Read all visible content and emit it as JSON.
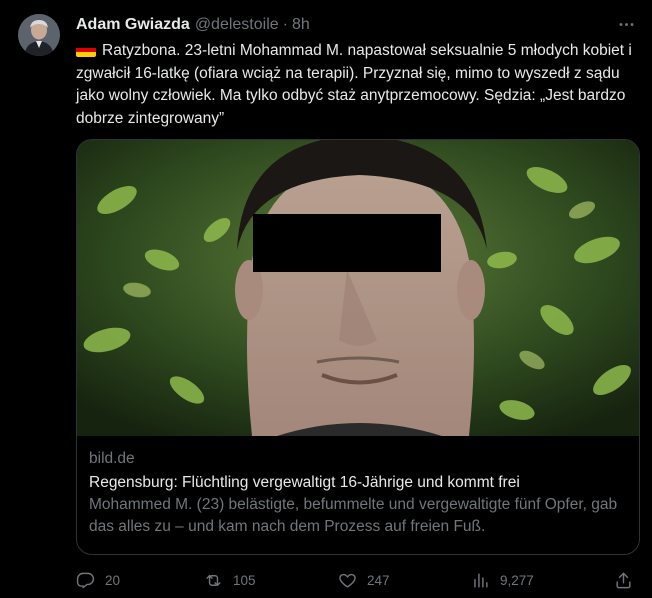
{
  "author": {
    "name": "Adam Gwiazda",
    "handle": "@delestoile",
    "separator": "·",
    "time": "8h"
  },
  "menu": {
    "more_label": "···"
  },
  "tweet": {
    "flag_icon": "germany-flag-icon",
    "flag_colors": [
      "#000000",
      "#dd0000",
      "#ffce00"
    ],
    "text": "Ratyzbona. 23-letni Mohammad M. napastował seksualnie 5 młodych kobiet i zgwałcił 16-latkę (ofiara wciąż na terapii). Przyznał się, mimo to wyszedł z sądu jako wolny człowiek. Ma tylko odbyć staż anytprzemocowy. Sędzia: „Jest bardzo dobrze zintegrowany”"
  },
  "card": {
    "domain": "bild.de",
    "title": "Regensburg: Flüchtling vergewaltigt 16-Jährige und kommt frei",
    "description": "Mohammed M. (23) belästigte, befummelte und vergewaltigte fünf Opfer, gab das alles zu – und kam nach dem Prozess auf freien Fuß."
  },
  "actions": {
    "reply_count": "20",
    "retweet_count": "105",
    "like_count": "247",
    "views_count": "9,277"
  },
  "colors": {
    "background": "#000000",
    "text_primary": "#e7e9ea",
    "text_secondary": "#71767b",
    "border": "#2f3336"
  }
}
